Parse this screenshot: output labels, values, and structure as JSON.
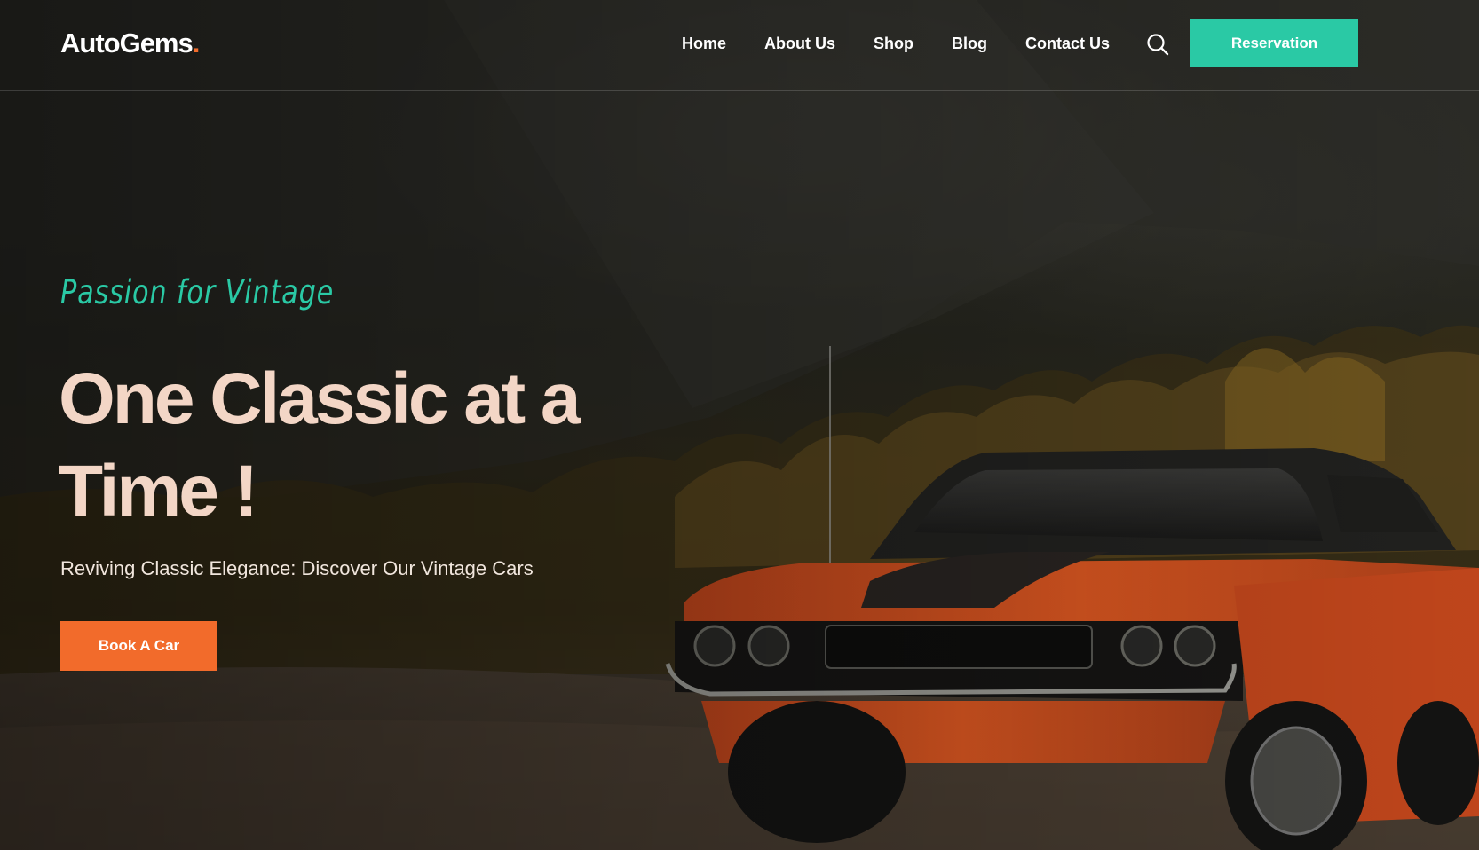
{
  "brand": {
    "name": "AutoGems",
    "dot": ".",
    "accent_color": "#f26b2b"
  },
  "nav": {
    "items": [
      {
        "label": "Home"
      },
      {
        "label": "About Us"
      },
      {
        "label": "Shop"
      },
      {
        "label": "Blog"
      },
      {
        "label": "Contact Us"
      }
    ],
    "search_icon": "search-icon",
    "reservation_label": "Reservation",
    "reservation_color": "#2ac9a5"
  },
  "hero": {
    "tagline": "Passion for Vintage",
    "headline": "One Classic at a Time !",
    "subheadline": "Reviving Classic Elegance: Discover Our Vintage Cars",
    "cta_label": "Book A Car",
    "cta_color": "#f26b2b",
    "headline_color": "#f3d6c6",
    "background": "orange-classic-muscle-car-in-autumn-forest"
  }
}
